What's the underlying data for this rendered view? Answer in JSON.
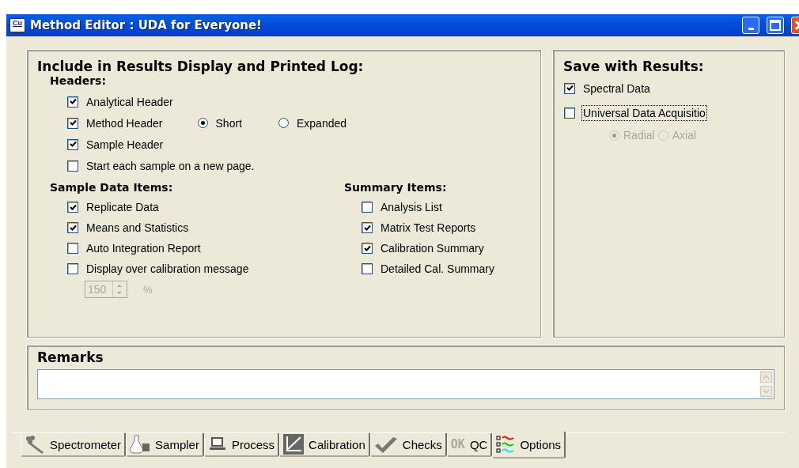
{
  "window": {
    "icon_text": "Cu",
    "title": "Method Editor : UDA for Everyone!"
  },
  "include": {
    "title": "Include in Results Display and Printed Log:",
    "headers": {
      "title": "Headers:",
      "items": [
        {
          "label": "Analytical Header",
          "checked": true
        },
        {
          "label": "Method Header",
          "checked": true,
          "options": [
            {
              "label": "Short",
              "selected": true
            },
            {
              "label": "Expanded",
              "selected": false
            }
          ]
        },
        {
          "label": "Sample Header",
          "checked": true
        },
        {
          "label": "Start each sample on a new page.",
          "checked": false
        }
      ]
    },
    "sample_data": {
      "title": "Sample Data Items:",
      "items": [
        {
          "label": "Replicate Data",
          "checked": true
        },
        {
          "label": "Means and Statistics",
          "checked": true
        },
        {
          "label": "Auto Integration Report",
          "checked": false
        },
        {
          "label": "Display over calibration message",
          "checked": false
        }
      ],
      "threshold": {
        "value": "150",
        "unit": "%",
        "disabled": true
      }
    },
    "summary": {
      "title": "Summary Items:",
      "items": [
        {
          "label": "Analysis List",
          "checked": false
        },
        {
          "label": "Matrix Test Reports",
          "checked": true
        },
        {
          "label": "Calibration Summary",
          "checked": true
        },
        {
          "label": "Detailed Cal. Summary",
          "checked": false
        }
      ]
    }
  },
  "save": {
    "title": "Save with Results:",
    "items": [
      {
        "label": "Spectral Data",
        "checked": true,
        "focused": false
      },
      {
        "label": "Universal Data Acquisitio",
        "checked": false,
        "focused": true
      }
    ],
    "view_disabled": true,
    "view_options": [
      {
        "label": "Radial",
        "selected": true
      },
      {
        "label": "Axial",
        "selected": false
      }
    ]
  },
  "remarks": {
    "title": "Remarks"
  },
  "tabs": [
    {
      "label": "Spectrometer",
      "kind": "spectrometer",
      "selected": false
    },
    {
      "label": "Sampler",
      "kind": "sampler",
      "selected": false
    },
    {
      "label": "Process",
      "kind": "process",
      "selected": false
    },
    {
      "label": "Calibration",
      "kind": "calibration",
      "selected": false
    },
    {
      "label": "Checks",
      "kind": "checks",
      "selected": false
    },
    {
      "label": "QC",
      "kind": "qc",
      "icon_text": "OK",
      "selected": false
    },
    {
      "label": "Options",
      "kind": "options",
      "selected": true
    }
  ]
}
